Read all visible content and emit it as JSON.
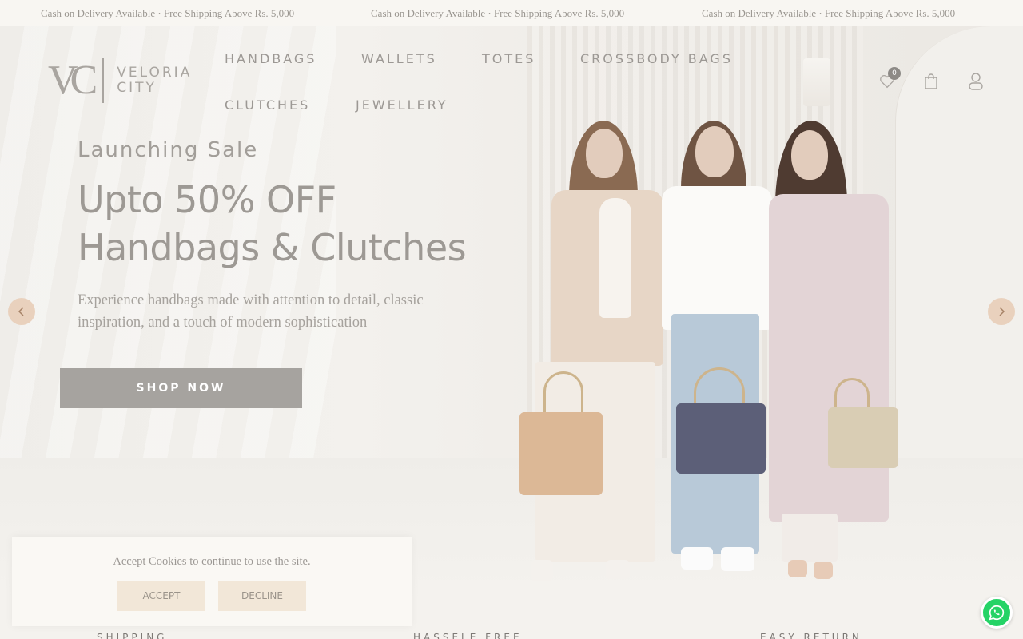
{
  "announcement": {
    "items": [
      "Cash on Delivery Available · Free Shipping Above Rs. 5,000",
      "Cash on Delivery Available · Free Shipping Above Rs. 5,000",
      "Cash on Delivery Available · Free Shipping Above Rs. 5,000"
    ]
  },
  "header": {
    "logo_mark": "VC",
    "logo_line1": "VELORIA",
    "logo_line2": "CITY",
    "nav": [
      "HANDBAGS",
      "WALLETS",
      "TOTES",
      "CROSSBODY BAGS",
      "CLUTCHES",
      "JEWELLERY"
    ],
    "wishlist_count": "0",
    "icons": [
      "heart-icon",
      "shopping-bag-icon",
      "user-icon"
    ]
  },
  "hero": {
    "eyebrow": "Launching Sale",
    "headline_line1": "Upto 50% OFF",
    "headline_line2": "Handbags & Clutches",
    "subtext": "Experience handbags made with attention to detail, classic inspiration, and a touch of modern sophistication",
    "cta": "SHOP NOW",
    "arrow_prev": "‹",
    "arrow_next": "›"
  },
  "features": [
    "SHIPPING",
    "HASSELE FREE",
    "EASY RETURN"
  ],
  "cookie": {
    "message": "Accept Cookies to continue to use the site.",
    "accept": "ACCEPT",
    "decline": "DECLINE"
  },
  "colors": {
    "accent_button": "#a6a39f",
    "arrow_bg": "#e9d1bd",
    "cookie_button_bg": "#f2e7d8",
    "whatsapp": "#25d366"
  }
}
